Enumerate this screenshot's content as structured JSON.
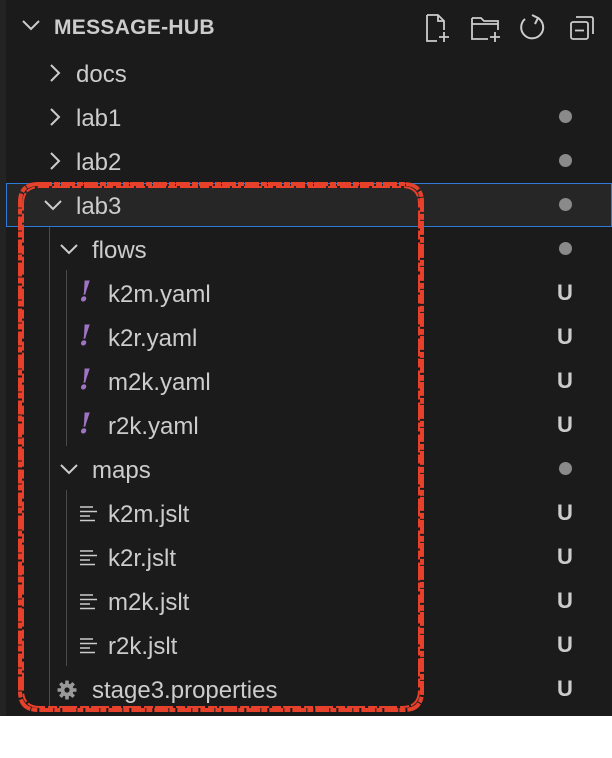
{
  "header": {
    "title": "MESSAGE-HUB",
    "actions": [
      {
        "name": "new-file-icon"
      },
      {
        "name": "new-folder-icon"
      },
      {
        "name": "refresh-icon"
      },
      {
        "name": "collapse-all-icon"
      }
    ]
  },
  "tree": [
    {
      "label": "docs",
      "kind": "folder",
      "expanded": false,
      "status": ""
    },
    {
      "label": "lab1",
      "kind": "folder",
      "expanded": false,
      "status": "dot"
    },
    {
      "label": "lab2",
      "kind": "folder",
      "expanded": false,
      "status": "dot"
    },
    {
      "label": "lab3",
      "kind": "folder",
      "expanded": true,
      "status": "dot",
      "selected": true
    },
    {
      "label": "flows",
      "kind": "folder",
      "expanded": true,
      "status": "dot"
    },
    {
      "label": "k2m.yaml",
      "kind": "yaml",
      "status": "U",
      "yaml_glyph": "!"
    },
    {
      "label": "k2r.yaml",
      "kind": "yaml",
      "status": "U",
      "yaml_glyph": "!"
    },
    {
      "label": "m2k.yaml",
      "kind": "yaml",
      "status": "U",
      "yaml_glyph": "!"
    },
    {
      "label": "r2k.yaml",
      "kind": "yaml",
      "status": "U",
      "yaml_glyph": "!"
    },
    {
      "label": "maps",
      "kind": "folder",
      "expanded": true,
      "status": "dot"
    },
    {
      "label": "k2m.jslt",
      "kind": "text",
      "status": "U"
    },
    {
      "label": "k2r.jslt",
      "kind": "text",
      "status": "U"
    },
    {
      "label": "m2k.jslt",
      "kind": "text",
      "status": "U"
    },
    {
      "label": "r2k.jslt",
      "kind": "text",
      "status": "U"
    },
    {
      "label": "stage3.properties",
      "kind": "settings",
      "status": "U"
    }
  ],
  "colors": {
    "background": "#1b1b1c",
    "text": "#cccccc",
    "yaml_icon": "#a074c4",
    "selection_border": "#2f7ad7",
    "annotation": "#e8412b"
  }
}
